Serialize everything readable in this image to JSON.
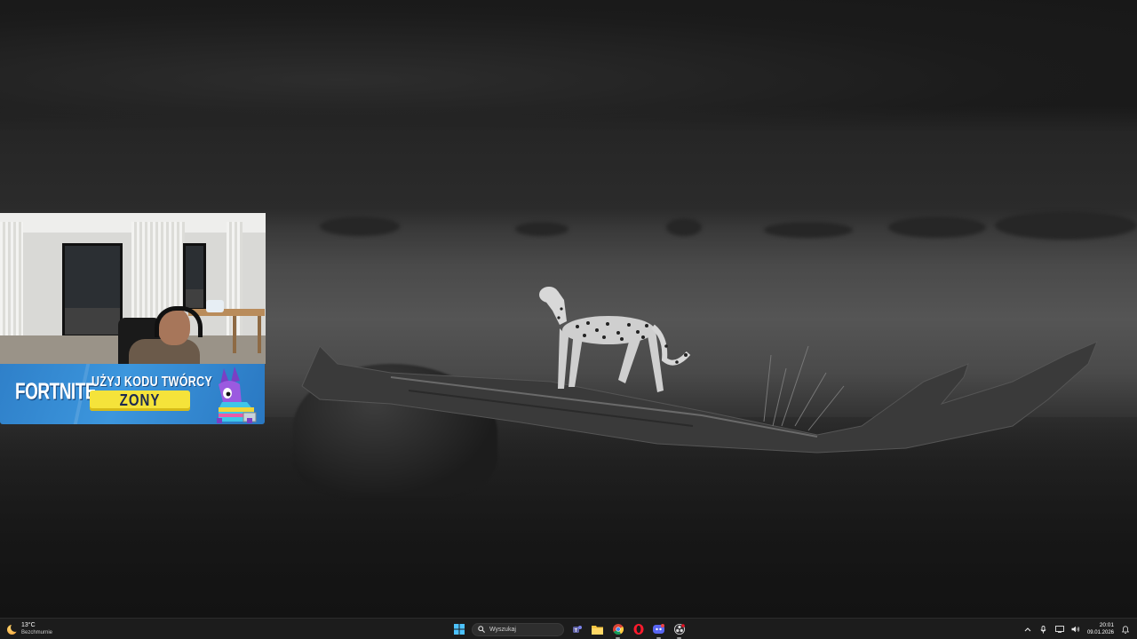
{
  "wallpaper": {
    "description_icon": "cheetah-wallpaper"
  },
  "overlay": {
    "banner": {
      "logo_text": "FORTNITE",
      "title": "UŻYJ KODU TWÓRCY",
      "code": "ZONY"
    }
  },
  "taskbar": {
    "weather": {
      "temp": "13°C",
      "desc": "Bezchmurnie"
    },
    "search": {
      "placeholder": "Wyszukaj"
    },
    "apps": [
      "windows-start-icon",
      "search-icon",
      "teams-icon",
      "file-explorer-icon",
      "chrome-icon",
      "opera-icon",
      "discord-icon",
      "obs-icon"
    ],
    "tray": [
      "chevron-up-icon",
      "microphone-icon",
      "network-icon",
      "volume-icon"
    ],
    "clock": {
      "time": "20:01",
      "date": "09.01.2026"
    }
  },
  "colors": {
    "banner_blue": "#3c96dd",
    "code_yellow": "#f5e33a",
    "taskbar": "#1c1c1c"
  }
}
